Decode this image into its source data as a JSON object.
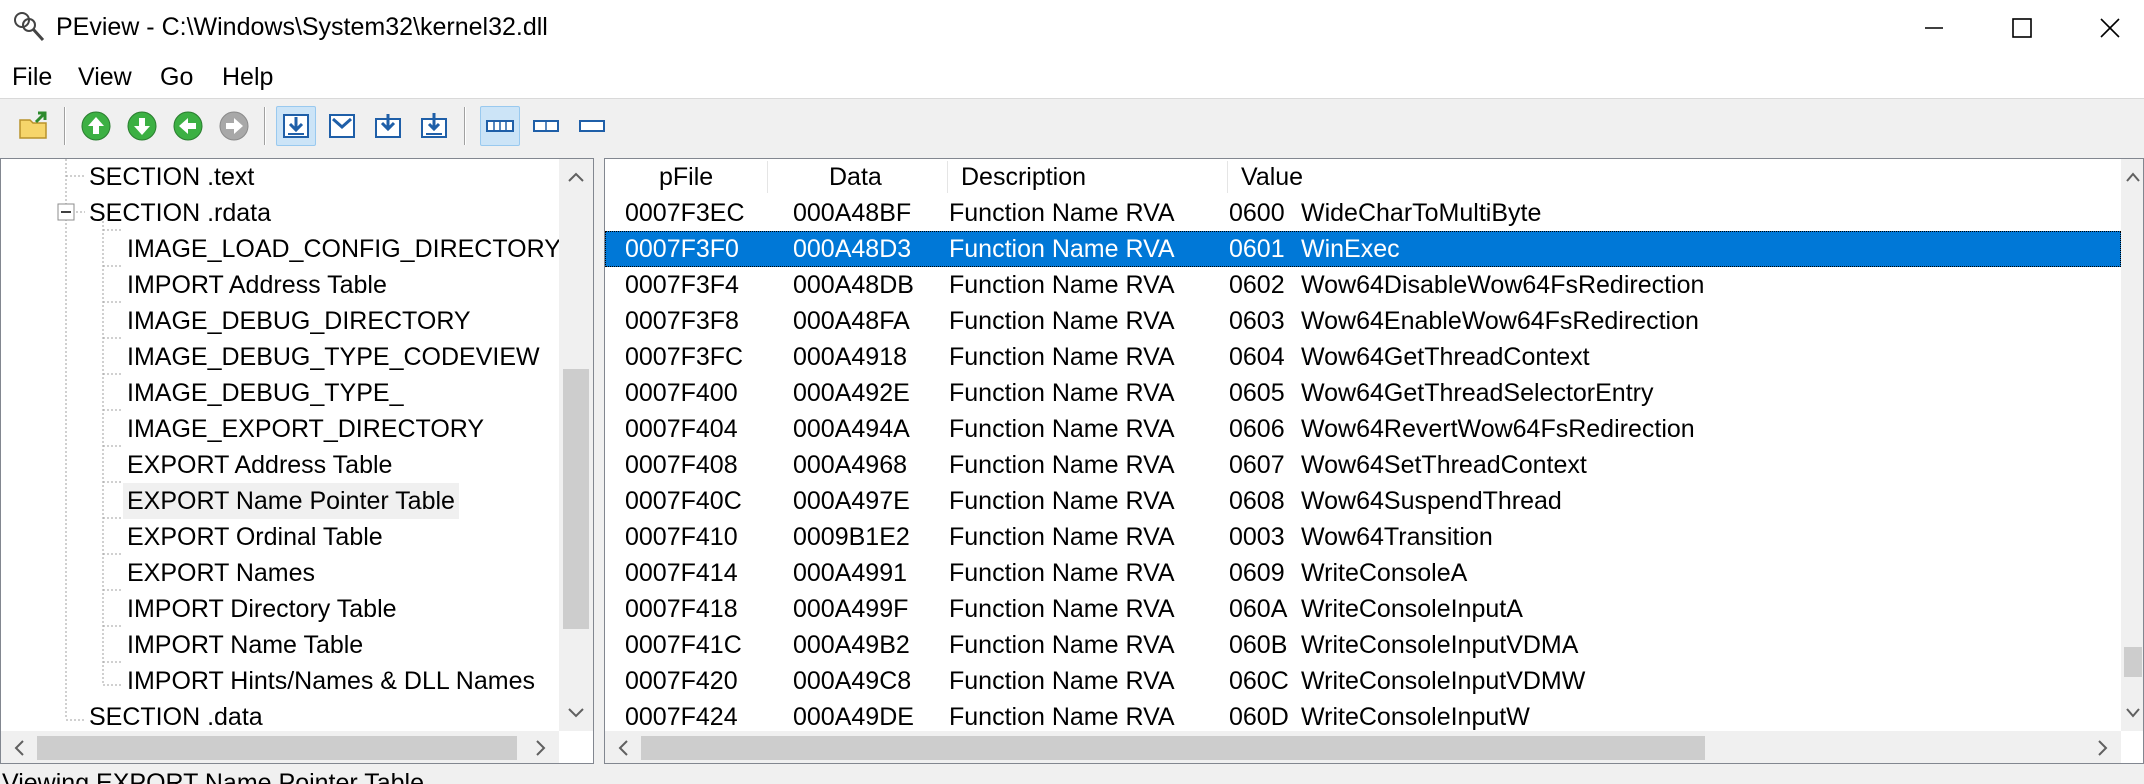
{
  "window": {
    "title": "PEview - C:\\Windows\\System32\\kernel32.dll"
  },
  "menu": [
    "File",
    "View",
    "Go",
    "Help"
  ],
  "toolbar": {
    "icons": [
      "open-file-icon",
      "up-arrow-icon",
      "down-arrow-icon",
      "back-arrow-icon",
      "forward-arrow-icon",
      "view-raw-icon",
      "view-header-icon",
      "view-section-icon",
      "view-data-icon",
      "layout-wide-icon",
      "layout-split-icon",
      "layout-narrow-icon"
    ]
  },
  "tree": {
    "items": [
      {
        "label": "SECTION .text",
        "level": 1,
        "expander": "none"
      },
      {
        "label": "SECTION .rdata",
        "level": 1,
        "expander": "minus"
      },
      {
        "label": "IMAGE_LOAD_CONFIG_DIRECTORY",
        "level": 2
      },
      {
        "label": "IMPORT Address Table",
        "level": 2
      },
      {
        "label": "IMAGE_DEBUG_DIRECTORY",
        "level": 2
      },
      {
        "label": "IMAGE_DEBUG_TYPE_CODEVIEW",
        "level": 2
      },
      {
        "label": "IMAGE_DEBUG_TYPE_",
        "level": 2
      },
      {
        "label": "IMAGE_EXPORT_DIRECTORY",
        "level": 2
      },
      {
        "label": "EXPORT Address Table",
        "level": 2
      },
      {
        "label": "EXPORT Name Pointer Table",
        "level": 2,
        "selected": true
      },
      {
        "label": "EXPORT Ordinal Table",
        "level": 2
      },
      {
        "label": "EXPORT Names",
        "level": 2
      },
      {
        "label": "IMPORT Directory Table",
        "level": 2
      },
      {
        "label": "IMPORT Name Table",
        "level": 2
      },
      {
        "label": "IMPORT Hints/Names & DLL Names",
        "level": 2
      },
      {
        "label": "SECTION .data",
        "level": 1,
        "expander": "none"
      }
    ]
  },
  "list": {
    "columns": [
      "pFile",
      "Data",
      "Description",
      "Value"
    ],
    "rows": [
      {
        "pfile": "0007F3EC",
        "data": "000A48BF",
        "desc": "Function Name RVA",
        "ord": "0600",
        "name": "WideCharToMultiByte"
      },
      {
        "pfile": "0007F3F0",
        "data": "000A48D3",
        "desc": "Function Name RVA",
        "ord": "0601",
        "name": "WinExec",
        "selected": true
      },
      {
        "pfile": "0007F3F4",
        "data": "000A48DB",
        "desc": "Function Name RVA",
        "ord": "0602",
        "name": "Wow64DisableWow64FsRedirection"
      },
      {
        "pfile": "0007F3F8",
        "data": "000A48FA",
        "desc": "Function Name RVA",
        "ord": "0603",
        "name": "Wow64EnableWow64FsRedirection"
      },
      {
        "pfile": "0007F3FC",
        "data": "000A4918",
        "desc": "Function Name RVA",
        "ord": "0604",
        "name": "Wow64GetThreadContext"
      },
      {
        "pfile": "0007F400",
        "data": "000A492E",
        "desc": "Function Name RVA",
        "ord": "0605",
        "name": "Wow64GetThreadSelectorEntry"
      },
      {
        "pfile": "0007F404",
        "data": "000A494A",
        "desc": "Function Name RVA",
        "ord": "0606",
        "name": "Wow64RevertWow64FsRedirection"
      },
      {
        "pfile": "0007F408",
        "data": "000A4968",
        "desc": "Function Name RVA",
        "ord": "0607",
        "name": "Wow64SetThreadContext"
      },
      {
        "pfile": "0007F40C",
        "data": "000A497E",
        "desc": "Function Name RVA",
        "ord": "0608",
        "name": "Wow64SuspendThread"
      },
      {
        "pfile": "0007F410",
        "data": "0009B1E2",
        "desc": "Function Name RVA",
        "ord": "0003",
        "name": "Wow64Transition"
      },
      {
        "pfile": "0007F414",
        "data": "000A4991",
        "desc": "Function Name RVA",
        "ord": "0609",
        "name": "WriteConsoleA"
      },
      {
        "pfile": "0007F418",
        "data": "000A499F",
        "desc": "Function Name RVA",
        "ord": "060A",
        "name": "WriteConsoleInputA"
      },
      {
        "pfile": "0007F41C",
        "data": "000A49B2",
        "desc": "Function Name RVA",
        "ord": "060B",
        "name": "WriteConsoleInputVDMA"
      },
      {
        "pfile": "0007F420",
        "data": "000A49C8",
        "desc": "Function Name RVA",
        "ord": "060C",
        "name": "WriteConsoleInputVDMW"
      },
      {
        "pfile": "0007F424",
        "data": "000A49DE",
        "desc": "Function Name RVA",
        "ord": "060D",
        "name": "WriteConsoleInputW"
      }
    ]
  },
  "status": {
    "text": "Viewing EXPORT Name Pointer Table"
  },
  "colors": {
    "selection": "#0078d7",
    "toolbar_bg": "#f0f0f0",
    "pressed_bg": "#cce4f7",
    "arrow_green": "#3cb043"
  }
}
